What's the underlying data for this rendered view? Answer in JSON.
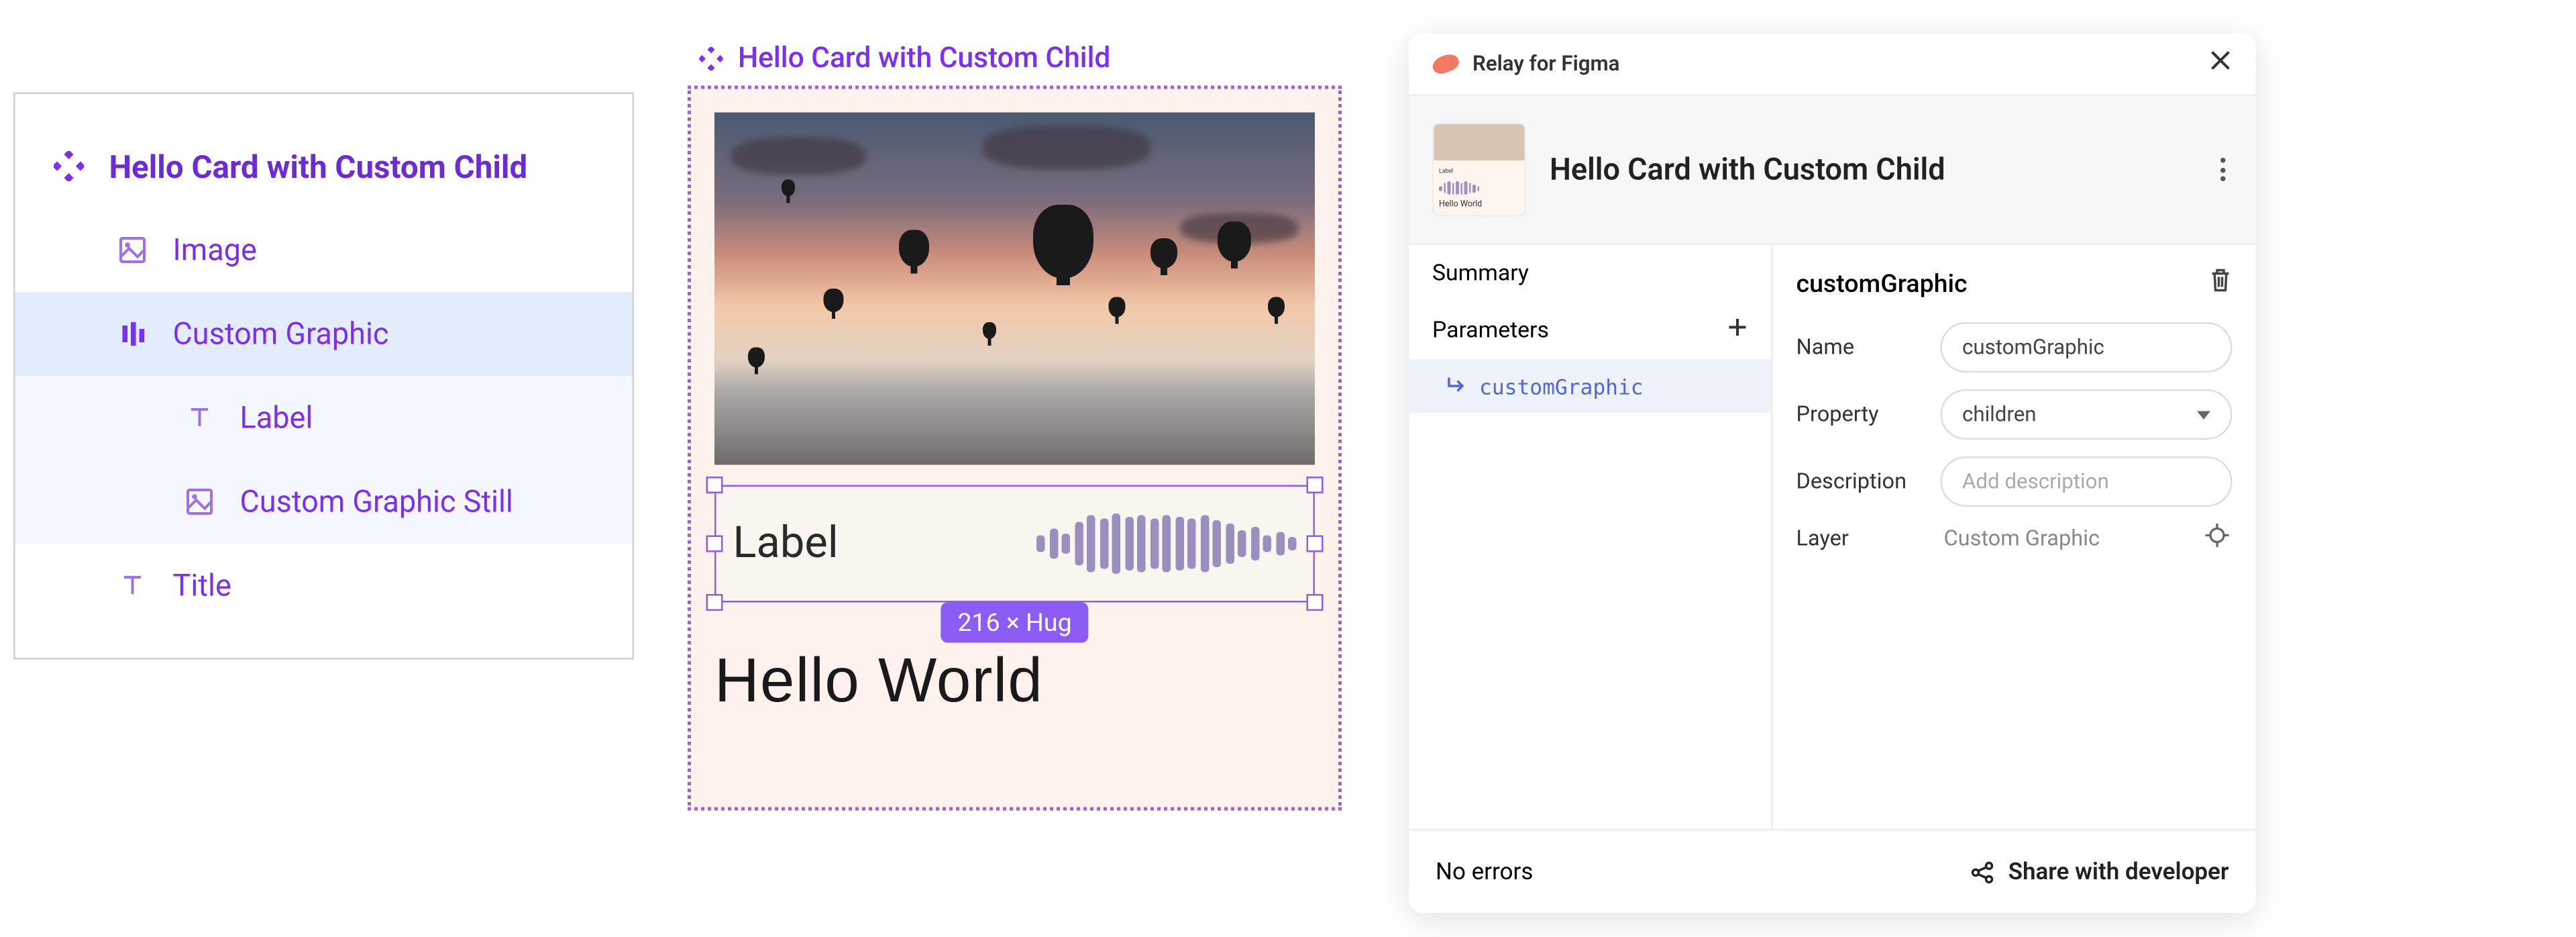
{
  "layers": {
    "root": "Hello Card with Custom Child",
    "image": "Image",
    "custom_graphic": "Custom Graphic",
    "label": "Label",
    "custom_graphic_still": "Custom Graphic Still",
    "title": "Title"
  },
  "canvas": {
    "frame_label": "Hello Card with Custom Child",
    "selection_label": "Label",
    "size_badge": "216 × Hug",
    "card_title": "Hello World"
  },
  "relay": {
    "app_title": "Relay for Figma",
    "header_title": "Hello Card with Custom Child",
    "side": {
      "summary": "Summary",
      "parameters": "Parameters",
      "param_item": "customGraphic"
    },
    "main": {
      "title": "customGraphic",
      "name_label": "Name",
      "name_value": "customGraphic",
      "property_label": "Property",
      "property_value": "children",
      "description_label": "Description",
      "description_placeholder": "Add description",
      "layer_label": "Layer",
      "layer_value": "Custom Graphic"
    },
    "footer": {
      "status": "No errors",
      "share": "Share with developer"
    },
    "thumb_title": "Hello World",
    "thumb_label": "Label"
  }
}
